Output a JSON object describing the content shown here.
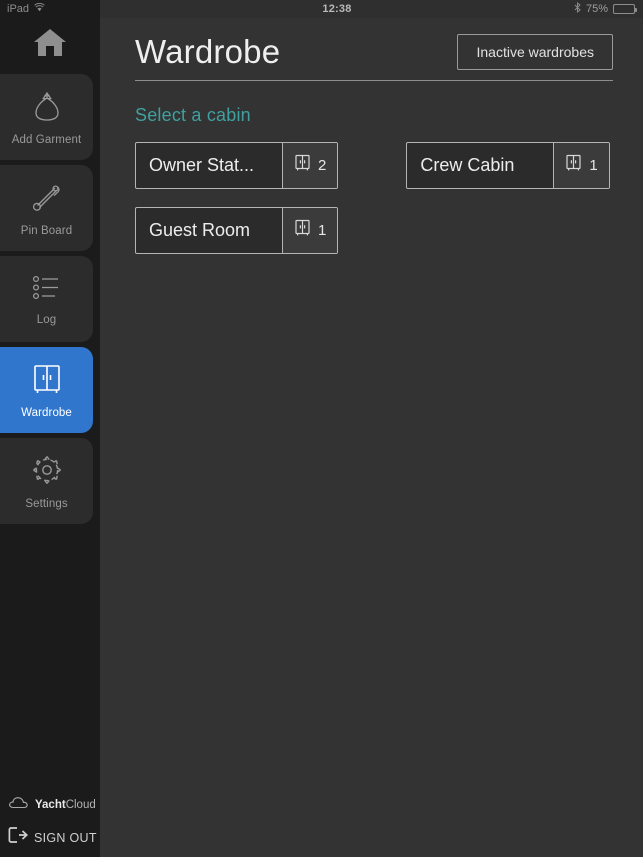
{
  "statusbar": {
    "device_label": "iPad",
    "wifi_icon": "wifi-icon",
    "time": "12:38",
    "bluetooth_icon": "bluetooth-icon",
    "battery_percent": "75%",
    "battery_level": 75
  },
  "sidebar": {
    "home_icon": "home-icon",
    "items": [
      {
        "label": "Add Garment",
        "icon": "garment-bag-icon",
        "active": false
      },
      {
        "label": "Pin Board",
        "icon": "safety-pin-icon",
        "active": false
      },
      {
        "label": "Log",
        "icon": "list-log-icon",
        "active": false
      },
      {
        "label": "Wardrobe",
        "icon": "wardrobe-icon",
        "active": true
      },
      {
        "label": "Settings",
        "icon": "gear-icon",
        "active": false
      }
    ],
    "footer": {
      "brand_icon": "cloud-icon",
      "brand_bold": "Yacht",
      "brand_light": "Cloud",
      "signout_icon": "sign-out-icon",
      "signout_label": "SIGN OUT"
    }
  },
  "main": {
    "title": "Wardrobe",
    "inactive_button": "Inactive wardrobes",
    "section_label": "Select a cabin",
    "cabins": [
      {
        "name": "Owner Stat...",
        "count": "2",
        "icon": "wardrobe-icon"
      },
      {
        "name": "Crew Cabin",
        "count": "1",
        "icon": "wardrobe-icon"
      },
      {
        "name": "Guest Room",
        "count": "1",
        "icon": "wardrobe-icon"
      }
    ]
  },
  "colors": {
    "sidebar_bg": "#1b1b1b",
    "nav_item_bg": "#2c2c2c",
    "accent_blue": "#3076cc",
    "accent_teal": "#40a0a0",
    "main_bg": "#333333",
    "card_bg": "#2b2b2b",
    "card_border": "#b4b4b4"
  }
}
